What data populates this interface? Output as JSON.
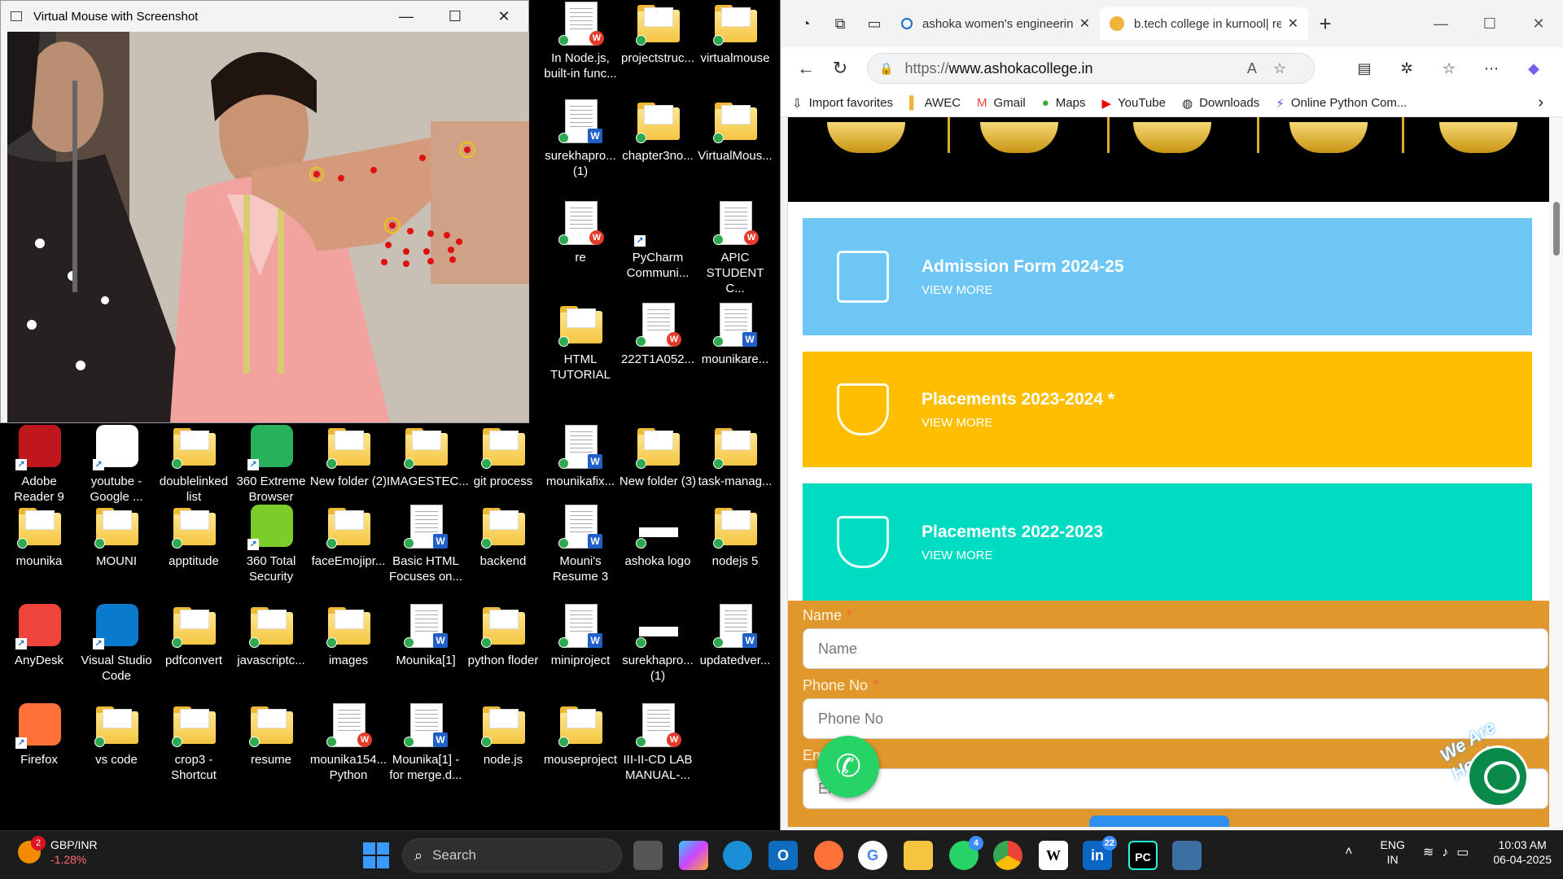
{
  "camera_window": {
    "title": "Virtual Mouse with Screenshot",
    "controls": [
      "—",
      "☐",
      "✕"
    ]
  },
  "desktop_icons": [
    {
      "label": "Adobe Reader 9",
      "type": "app"
    },
    {
      "label": "youtube - Google ...",
      "type": "app"
    },
    {
      "label": "doublelinked list",
      "type": "folder"
    },
    {
      "label": "360 Extreme Browser",
      "type": "app"
    },
    {
      "label": "New folder (2)",
      "type": "folder"
    },
    {
      "label": "IMAGESTEC...",
      "type": "folder"
    },
    {
      "label": "git process",
      "type": "folder"
    },
    {
      "label": "mounikafix...",
      "type": "doc"
    },
    {
      "label": "New folder (3)",
      "type": "folder"
    },
    {
      "label": "task-manag...",
      "type": "folder"
    },
    {
      "label": "In Node.js, built-in func...",
      "type": "doc"
    },
    {
      "label": "projectstruc...",
      "type": "folder"
    },
    {
      "label": "virtualmouse",
      "type": "folder"
    },
    {
      "label": "surekhapro... (1)",
      "type": "doc"
    },
    {
      "label": "chapter3no...",
      "type": "folder"
    },
    {
      "label": "VirtualMous...",
      "type": "folder"
    },
    {
      "label": "re",
      "type": "doc"
    },
    {
      "label": "PyCharm Communi...",
      "type": "app"
    },
    {
      "label": "APIC STUDENT C...",
      "type": "doc"
    },
    {
      "label": "HTML TUTORIAL",
      "type": "folder"
    },
    {
      "label": "222T1A052...",
      "type": "doc"
    },
    {
      "label": "mounikare...",
      "type": "doc"
    },
    {
      "label": "mounika",
      "type": "folder"
    },
    {
      "label": "MOUNI",
      "type": "folder"
    },
    {
      "label": "apptitude",
      "type": "folder"
    },
    {
      "label": "360 Total Security",
      "type": "app"
    },
    {
      "label": "faceEmojipr...",
      "type": "folder"
    },
    {
      "label": "Basic HTML Focuses on...",
      "type": "doc"
    },
    {
      "label": "backend",
      "type": "folder"
    },
    {
      "label": "Mouni's Resume 3",
      "type": "doc"
    },
    {
      "label": "ashoka logo",
      "type": "image"
    },
    {
      "label": "nodejs 5",
      "type": "folder"
    },
    {
      "label": "AnyDesk",
      "type": "app"
    },
    {
      "label": "Visual Studio Code",
      "type": "app"
    },
    {
      "label": "pdfconvert",
      "type": "folder"
    },
    {
      "label": "javascriptc...",
      "type": "folder"
    },
    {
      "label": "images",
      "type": "folder"
    },
    {
      "label": "Mounika[1]",
      "type": "doc"
    },
    {
      "label": "python floder",
      "type": "folder"
    },
    {
      "label": "miniproject",
      "type": "doc"
    },
    {
      "label": "surekhapro... (1)",
      "type": "image"
    },
    {
      "label": "updatedver...",
      "type": "doc"
    },
    {
      "label": "Firefox",
      "type": "app"
    },
    {
      "label": "vs code",
      "type": "folder"
    },
    {
      "label": "crop3 - Shortcut",
      "type": "folder"
    },
    {
      "label": "resume",
      "type": "folder"
    },
    {
      "label": "mounika154... Python",
      "type": "doc"
    },
    {
      "label": "Mounika[1] - for merge.d...",
      "type": "doc"
    },
    {
      "label": "node.js",
      "type": "folder"
    },
    {
      "label": "mouseproject",
      "type": "folder"
    },
    {
      "label": "III-II-CD LAB MANUAL-...",
      "type": "doc"
    }
  ],
  "browser": {
    "tabs": [
      {
        "title": "ashoka women's engineering",
        "active": false
      },
      {
        "title": "b.tech college in kurnool| re",
        "active": true
      }
    ],
    "address": {
      "scheme": "https://",
      "host": "www.ashokacollege.in"
    },
    "favorites": [
      "Import favorites",
      "AWEC",
      "Gmail",
      "Maps",
      "YouTube",
      "Downloads",
      "Online Python Com..."
    ],
    "cards": [
      {
        "title": "Admission Form 2024-25",
        "more": "VIEW MORE",
        "color": "#6ec6f4"
      },
      {
        "title": "Placements 2023-2024 *",
        "more": "VIEW MORE",
        "color": "#ffbf00"
      },
      {
        "title": "Placements 2022-2023",
        "more": "VIEW MORE",
        "color": "#00dcc2"
      }
    ],
    "form": {
      "name_label": "Name",
      "name_placeholder": "Name",
      "phone_label": "Phone No",
      "phone_placeholder": "Phone No",
      "email_label": "Em",
      "email_placeholder": "Em",
      "required_mark": "*"
    },
    "chat_badge": "We Are Here!"
  },
  "taskbar": {
    "ticker_pair": "GBP/INR",
    "ticker_change": "-1.28%",
    "ticker_badge": "2",
    "search_placeholder": "Search",
    "whatsapp_badge": "4",
    "linkedin_badge": "22",
    "lang_top": "ENG",
    "lang_bottom": "IN",
    "time": "10:03 AM",
    "date": "06-04-2025"
  }
}
